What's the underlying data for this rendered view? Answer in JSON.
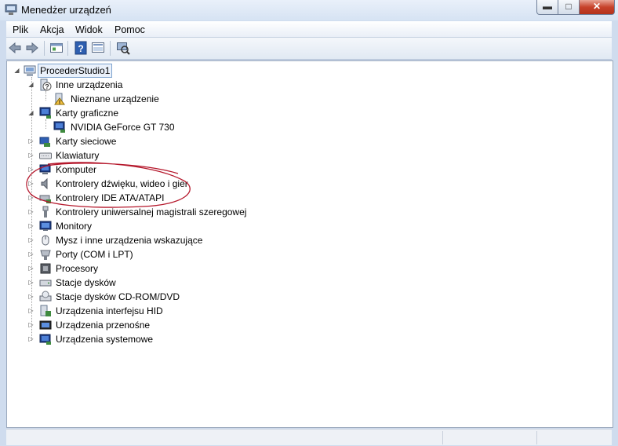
{
  "window": {
    "title": "Menedżer urządzeń"
  },
  "caption_buttons": {
    "minimize": "▬",
    "maximize": "□",
    "close": "✕"
  },
  "menu": [
    "Plik",
    "Akcja",
    "Widok",
    "Pomoc"
  ],
  "toolbar": [
    "back-icon",
    "forward-icon",
    "properties-icon",
    "help-icon",
    "scan-hardware-icon"
  ],
  "tree": {
    "root": "ProcederStudio1",
    "categories": [
      {
        "label": "Inne urządzenia",
        "icon": "unknown-device-icon",
        "expanded": true,
        "children": [
          {
            "label": "Nieznane urządzenie",
            "icon": "warning-device-icon"
          }
        ]
      },
      {
        "label": "Karty graficzne",
        "icon": "display-adapter-icon",
        "expanded": true,
        "children": [
          {
            "label": "NVIDIA GeForce GT 730",
            "icon": "display-adapter-icon"
          }
        ]
      },
      {
        "label": "Karty sieciowe",
        "icon": "network-adapter-icon",
        "expanded": false
      },
      {
        "label": "Klawiatury",
        "icon": "keyboard-icon",
        "expanded": false
      },
      {
        "label": "Komputer",
        "icon": "computer-icon",
        "expanded": false
      },
      {
        "label": "Kontrolery dźwięku, wideo i gier",
        "icon": "speaker-icon",
        "expanded": false
      },
      {
        "label": "Kontrolery IDE ATA/ATAPI",
        "icon": "ide-controller-icon",
        "expanded": false
      },
      {
        "label": "Kontrolery uniwersalnej magistrali szeregowej",
        "icon": "usb-icon",
        "expanded": false
      },
      {
        "label": "Monitory",
        "icon": "monitor-icon",
        "expanded": false
      },
      {
        "label": "Mysz i inne urządzenia wskazujące",
        "icon": "mouse-icon",
        "expanded": false
      },
      {
        "label": "Porty (COM i LPT)",
        "icon": "port-icon",
        "expanded": false
      },
      {
        "label": "Procesory",
        "icon": "processor-icon",
        "expanded": false
      },
      {
        "label": "Stacje dysków",
        "icon": "disk-drive-icon",
        "expanded": false
      },
      {
        "label": "Stacje dysków CD-ROM/DVD",
        "icon": "dvd-drive-icon",
        "expanded": false
      },
      {
        "label": "Urządzenia interfejsu HID",
        "icon": "hid-icon",
        "expanded": false
      },
      {
        "label": "Urządzenia przenośne",
        "icon": "portable-device-icon",
        "expanded": false
      },
      {
        "label": "Urządzenia systemowe",
        "icon": "system-device-icon",
        "expanded": false
      }
    ]
  },
  "colors": {
    "annotation": "#b5182c",
    "selection_border": "#7da2ce",
    "window_frame": "#cfdcee"
  }
}
